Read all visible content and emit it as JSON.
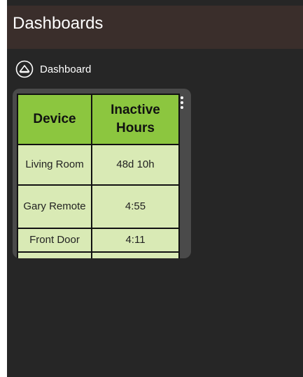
{
  "header": {
    "title": "Dashboards"
  },
  "breadcrumb": {
    "icon": "home-icon",
    "label": "Dashboard"
  },
  "tile": {
    "menu_icon": "kebab-menu-icon",
    "table": {
      "columns": [
        "Device",
        "Inactive Hours"
      ],
      "rows": [
        {
          "device": "Living Room",
          "inactive": "48d 10h"
        },
        {
          "device": "Gary Remote",
          "inactive": "4:55"
        },
        {
          "device": "Front Door",
          "inactive": "4:11"
        }
      ]
    }
  },
  "colors": {
    "header_bg": "#3a2e2b",
    "page_bg": "#262626",
    "tile_bg": "#4a4a4a",
    "table_header_bg": "#8cc63f",
    "table_cell_bg": "#d9eab5"
  }
}
